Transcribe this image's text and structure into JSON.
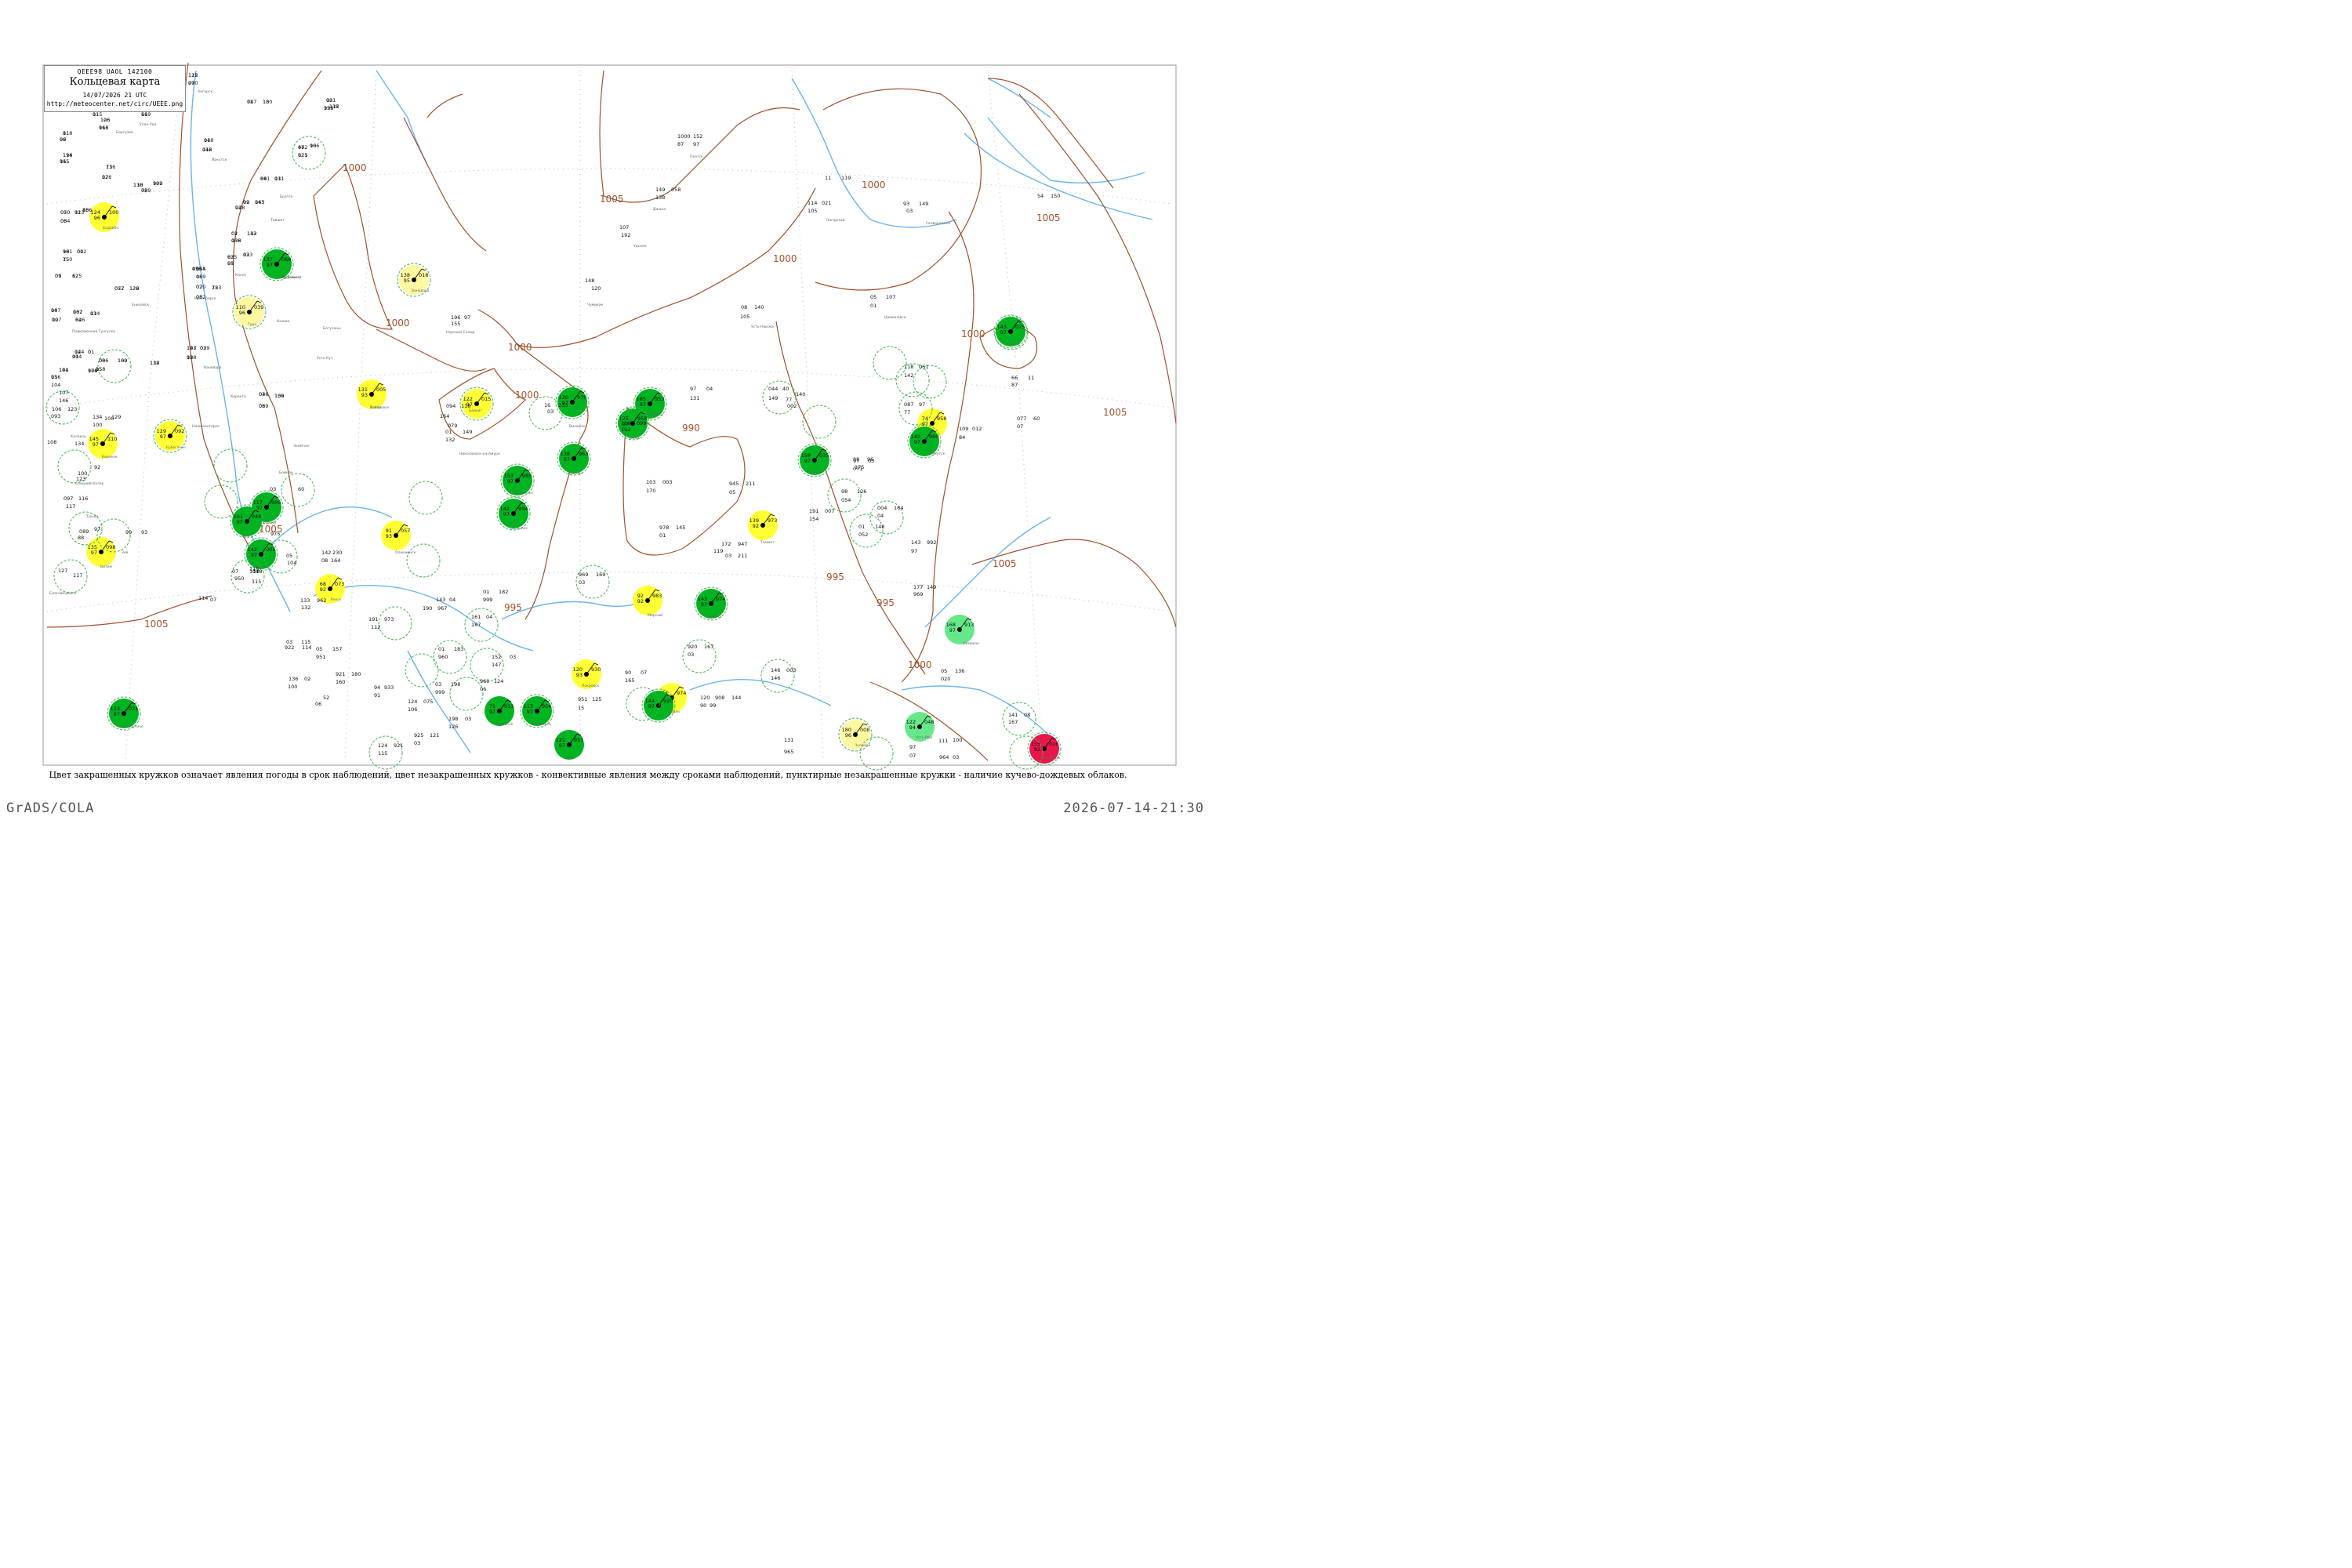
{
  "legend": {
    "codes": "QEEE98  UAOL  142100",
    "title": "Кольцевая карта",
    "datetime": "14/07/2026 21 UTC",
    "url": "http://meteocenter.net/circ/UEEE.png"
  },
  "caption": "Цвет закрашенных кружков означает явления погоды в срок наблюдений, цвет незакрашенных кружков - конвективные явления между сроками наблюдений, пунктирные незакрашенные кружки - наличие кучево-дождевых облаков.",
  "footer": {
    "left": "GrADS/COLA",
    "right": "2026-07-14-21:30"
  },
  "colors": {
    "isobar": "#a0522d",
    "river": "#6ab4ee",
    "green_fill": "#00b321",
    "light_green_fill": "#66e88a",
    "yellow_fill": "#ffff33",
    "pale_yellow_fill": "#fff8a0",
    "red_fill": "#e8174a",
    "dashed_ring": "#3cb44b",
    "frame": "#999999"
  },
  "isobars": [
    {
      "label": "1000"
    },
    {
      "label": "1000"
    },
    {
      "label": "1000"
    },
    {
      "label": "1000"
    },
    {
      "label": "1000"
    },
    {
      "label": "1000"
    },
    {
      "label": "1000"
    },
    {
      "label": "1000"
    },
    {
      "label": "1005"
    },
    {
      "label": "1005"
    },
    {
      "label": "1005"
    },
    {
      "label": "1005"
    },
    {
      "label": "1005"
    },
    {
      "label": "1005"
    },
    {
      "label": "995"
    },
    {
      "label": "995"
    },
    {
      "label": "995"
    },
    {
      "label": "990"
    }
  ],
  "stations": [
    {
      "name": "station-24105",
      "id": "24105",
      "label": "Туруханск",
      "p": "068",
      "t": "137",
      "td": "97",
      "cloud": "8",
      "fill": "green",
      "ring": true
    },
    {
      "name": "station-23383",
      "label": "Бахта",
      "p": "005",
      "t": "131",
      "td": "93",
      "fill": "yellow",
      "ring": false
    },
    {
      "name": "station-23891",
      "p": "015",
      "t": "122",
      "td": "97",
      "fill": "yellow",
      "ring": true
    },
    {
      "name": "station-23552",
      "p": "018",
      "t": "138",
      "td": "95",
      "fill": "pale_yellow",
      "ring": true
    },
    {
      "name": "station-23274",
      "p": "039",
      "t": "110",
      "td": "96",
      "fill": "pale_yellow",
      "ring": true
    },
    {
      "name": "station-23662",
      "p": "092",
      "t": "129",
      "td": "97",
      "fill": "yellow",
      "ring": true
    },
    {
      "name": "station-23724",
      "p": "110",
      "t": "145",
      "td": "97",
      "fill": "yellow",
      "ring": false
    },
    {
      "name": "station-24722",
      "p": "100",
      "t": "124",
      "td": "96",
      "fill": "yellow",
      "ring": false
    },
    {
      "name": "station-29263",
      "p": "098",
      "t": "135",
      "td": "97",
      "fill": "yellow",
      "ring": false
    },
    {
      "name": "station-30054",
      "p": "057",
      "t": "91",
      "td": "93",
      "fill": "yellow",
      "ring": false
    },
    {
      "name": "station-30393",
      "p": "073",
      "t": "68",
      "td": "92",
      "fill": "yellow",
      "ring": false
    },
    {
      "name": "station-31004",
      "p": "983",
      "t": "92",
      "td": "92",
      "fill": "yellow",
      "ring": false
    },
    {
      "name": "station-31168",
      "p": "958",
      "t": "74",
      "td": "97",
      "fill": "yellow",
      "ring": false
    },
    {
      "name": "station-31329",
      "p": "930",
      "t": "120",
      "td": "93",
      "fill": "yellow",
      "ring": false
    },
    {
      "name": "station-31300",
      "p": "974",
      "t": "154",
      "td": "93",
      "fill": "yellow",
      "ring": false
    },
    {
      "name": "station-32389",
      "p": "973",
      "t": "139",
      "td": "92",
      "fill": "yellow",
      "ring": false
    },
    {
      "name": "station-32217",
      "p": "008",
      "t": "180",
      "td": "96",
      "fill": "pale_yellow",
      "ring": true
    },
    {
      "name": "station-31915",
      "p": "016",
      "t": "155",
      "td": "92",
      "fill": "red",
      "ring": true
    },
    {
      "name": "station-31137",
      "p": "048",
      "t": "122",
      "td": "94",
      "fill": "light_green",
      "ring": false
    },
    {
      "name": "station-30181",
      "p": "913",
      "t": "168",
      "td": "97",
      "fill": "light_green",
      "ring": false
    },
    {
      "name": "station-25551",
      "p": "075",
      "t": "143",
      "td": "97",
      "fill": "green",
      "ring": true
    },
    {
      "name": "station-24959",
      "p": "980",
      "t": "142",
      "td": "97",
      "fill": "green",
      "ring": true
    },
    {
      "name": "station-24643",
      "p": "035",
      "t": "158",
      "td": "97",
      "fill": "green",
      "ring": true
    },
    {
      "name": "station-24641",
      "p": "953",
      "t": "185",
      "td": "97",
      "fill": "green",
      "ring": true
    },
    {
      "name": "station-24507",
      "p": "970",
      "t": "120",
      "td": "97",
      "fill": "green",
      "ring": true
    },
    {
      "name": "station-24371",
      "p": "963",
      "t": "138",
      "td": "97",
      "fill": "green",
      "ring": true
    },
    {
      "name": "station-24136",
      "p": "985",
      "t": "153",
      "td": "97",
      "fill": "green",
      "ring": true
    },
    {
      "name": "station-24329",
      "p": "994",
      "t": "142",
      "td": "97",
      "fill": "green",
      "ring": true
    },
    {
      "name": "station-24266",
      "p": "986",
      "t": "117",
      "td": "97",
      "fill": "green",
      "ring": true
    },
    {
      "name": "station-30635",
      "p": "946",
      "t": "101",
      "td": "97",
      "fill": "green",
      "ring": true
    },
    {
      "name": "station-30554",
      "p": "005",
      "t": "142",
      "td": "97",
      "fill": "green",
      "ring": true
    },
    {
      "name": "station-30238",
      "p": "024",
      "t": "143",
      "td": "97",
      "fill": "green",
      "ring": true
    },
    {
      "name": "station-30372",
      "p": "021",
      "t": "123",
      "td": "97",
      "fill": "green",
      "ring": true
    },
    {
      "name": "station-29862",
      "p": "013",
      "t": "71",
      "td": "97",
      "fill": "green",
      "ring": false
    },
    {
      "name": "station-30433",
      "p": "954",
      "t": "113",
      "td": "97",
      "fill": "green",
      "ring": true
    },
    {
      "name": "station-30609",
      "p": "957",
      "t": "121",
      "td": "97",
      "fill": "green",
      "ring": false
    },
    {
      "name": "station-30844",
      "p": "958",
      "t": "125",
      "td": "97",
      "fill": "green",
      "ring": false
    },
    {
      "name": "station-31416",
      "p": "920",
      "t": "144",
      "td": "97",
      "fill": "green",
      "ring": true
    }
  ],
  "readings": [
    "112",
    "07",
    "119",
    "115",
    "106",
    "113",
    "118",
    "99",
    "116",
    "115",
    "116",
    "126",
    "118",
    "109",
    "089",
    "101",
    "117",
    "135",
    "027",
    "130",
    "04",
    "112",
    "072",
    "96",
    "125",
    "081",
    "111",
    "09",
    "143",
    "028",
    "01",
    "143",
    "138",
    "035",
    "133",
    "03",
    "155",
    "036",
    "159",
    "02",
    "153",
    "032",
    "143",
    "02",
    "138",
    "036",
    "139",
    "08",
    "136",
    "050",
    "113",
    "03",
    "161",
    "002",
    "150",
    "01",
    "125",
    "052",
    "129",
    "04",
    "107",
    "046",
    "107",
    "03",
    "124",
    "01",
    "114",
    "086",
    "109",
    "05",
    "104",
    "132",
    "104",
    "116",
    "104",
    "107",
    "146",
    "106",
    "123",
    "093",
    "134",
    "100",
    "129",
    "100",
    "134",
    "100",
    "92",
    "123",
    "097",
    "116",
    "117",
    "089",
    "97",
    "88",
    "99",
    "93",
    "127",
    "117",
    "108",
    "196",
    "97",
    "155",
    "233",
    "16",
    "03",
    "106",
    "099",
    "152",
    "01",
    "149",
    "132",
    "094",
    "118",
    "164",
    "079",
    "148",
    "120",
    "107",
    "192",
    "08",
    "140",
    "105",
    "149",
    "058",
    "138",
    "1000",
    "152",
    "87",
    "97",
    "54",
    "150",
    "93",
    "149",
    "03",
    "114",
    "021",
    "105",
    "11",
    "119",
    "05",
    "107",
    "01",
    "97",
    "04",
    "131",
    "044",
    "40",
    "149",
    "77",
    "140",
    "002",
    "88",
    "96",
    "071",
    "66",
    "11",
    "87",
    "077",
    "60",
    "07",
    "118",
    "051",
    "142",
    "087",
    "97",
    "77",
    "109",
    "012",
    "84",
    "103",
    "003",
    "170",
    "978",
    "145",
    "01",
    "172",
    "947",
    "119",
    "03",
    "211",
    "945",
    "211",
    "05",
    "177",
    "149",
    "969",
    "143",
    "992",
    "97",
    "01",
    "148",
    "052",
    "98",
    "126",
    "054",
    "97",
    "03",
    "175",
    "004",
    "164",
    "04",
    "191",
    "007",
    "154",
    "05",
    "136",
    "020",
    "141",
    "08",
    "167",
    "920",
    "167",
    "03",
    "120",
    "908",
    "90",
    "144",
    "99",
    "90",
    "07",
    "165",
    "951",
    "125",
    "15",
    "146",
    "003",
    "146",
    "01",
    "182",
    "999",
    "143",
    "04",
    "190",
    "967",
    "161",
    "04",
    "187",
    "969",
    "169",
    "03",
    "191",
    "973",
    "112",
    "01",
    "183",
    "960",
    "152",
    "03",
    "147",
    "960",
    "124",
    "06",
    "124",
    "075",
    "106",
    "03",
    "198",
    "999",
    "198",
    "03",
    "126",
    "925",
    "121",
    "03",
    "124",
    "921",
    "115",
    "921",
    "180",
    "160",
    "94",
    "933",
    "91",
    "03",
    "115",
    "922",
    "114",
    "05",
    "157",
    "951",
    "136",
    "02",
    "100",
    "52",
    "06",
    "164",
    "230",
    "142",
    "08",
    "133",
    "962",
    "132",
    "07",
    "114",
    "950",
    "114",
    "07",
    "115",
    "018",
    "115",
    "05",
    "104",
    "975",
    "60",
    "03",
    "131",
    "965",
    "97",
    "07",
    "111",
    "964",
    "100",
    "03",
    "125",
    "990",
    "66",
    "01",
    "126",
    "966",
    "81",
    "06",
    "194",
    "965",
    "73",
    "07",
    "130",
    "992",
    "72",
    "02",
    "138",
    "996",
    "78",
    "10",
    "118",
    "046",
    "48",
    "106",
    "021",
    "84",
    "03",
    "92",
    "065",
    "94",
    "02",
    "112",
    "056",
    "82",
    "02",
    "99",
    "074",
    "45",
    "06",
    "070",
    "72",
    "06",
    "107",
    "039",
    "98",
    "04",
    "106",
    "059",
    "86",
    "07",
    "92",
    "064",
    "98",
    "01",
    "75",
    "09",
    "62",
    "077",
    "126",
    "107",
    "09",
    "82",
    "062",
    "114",
    "04",
    "0",
    "00",
    "00",
    "160",
    "158",
    "976",
    "118",
    "141",
    "05"
  ],
  "place_names": [
    "Туруханск",
    "Бахта",
    "Байкит",
    "Ванавара",
    "Тура",
    "Ербогачен",
    "Киренск",
    "Бодайбо",
    "Витим",
    "Олекминск",
    "Ленск",
    "Мирный",
    "Якутск",
    "Покровск",
    "Алдан",
    "Томмот",
    "Чульман",
    "Нерюнгри",
    "Усть-Мая",
    "Оймякон",
    "Охотск",
    "Аян",
    "Тикси",
    "Жиганск",
    "Вилюйск",
    "Сунтар",
    "Верхоянск",
    "Саскылах",
    "Оленек",
    "Чара",
    "Тупик",
    "Могоча",
    "Шелопугино",
    "Сретенск",
    "Нерчинск",
    "Чита",
    "Хилок",
    "Улан-Удэ",
    "Баргузин",
    "Ангарск",
    "Иркутск",
    "Братск",
    "Тайшет",
    "Канск",
    "Красноярск",
    "Енисейск",
    "Подкаменная Тунгуска",
    "Ванавара",
    "Кежма",
    "Богучаны",
    "Усть-Кут",
    "Киренга",
    "Нижнеангарск",
    "Калакан",
    "Средний Калар",
    "Тындa",
    "Зея",
    "Благовещенск",
    "Экимчан",
    "Бомнак",
    "Норский Склад",
    "Николаевск-на-Амуре",
    "Чумикан",
    "Удское",
    "Джана",
    "Охотск",
    "Усть-Нюкжа",
    "Нагорный",
    "Сковородино",
    "Шимановск",
    "Свободный",
    "Хабаровск"
  ]
}
